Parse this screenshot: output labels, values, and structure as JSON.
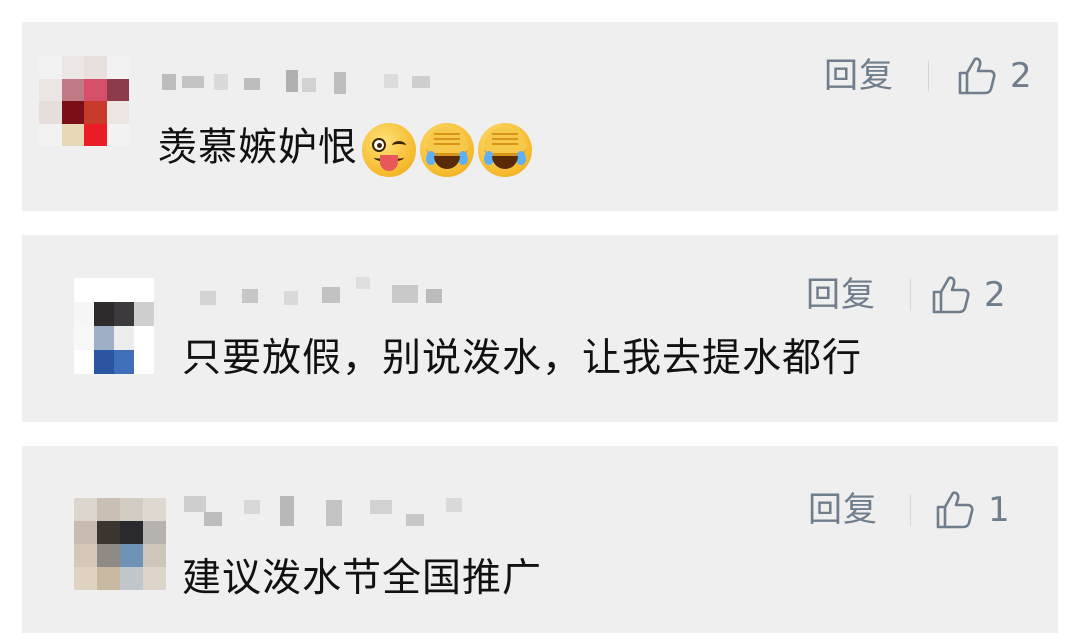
{
  "comments": [
    {
      "text": "羡慕嫉妒恨",
      "emojis": [
        "winking-tongue-emoji",
        "facepalm-laugh-emoji",
        "facepalm-laugh-emoji"
      ],
      "reply_label": "回复",
      "like_count": "2"
    },
    {
      "text": "只要放假，别说泼水，让我去提水都行",
      "reply_label": "回复",
      "like_count": "2"
    },
    {
      "text": "建议泼水节全国推广",
      "reply_label": "回复",
      "like_count": "1"
    }
  ],
  "icons": {
    "like": "thumbs-up-icon"
  },
  "colors": {
    "card_background": "#efefef",
    "action_text": "#6f7d8c",
    "comment_text": "#111111",
    "name_mosaic": "#c9c9c9"
  }
}
